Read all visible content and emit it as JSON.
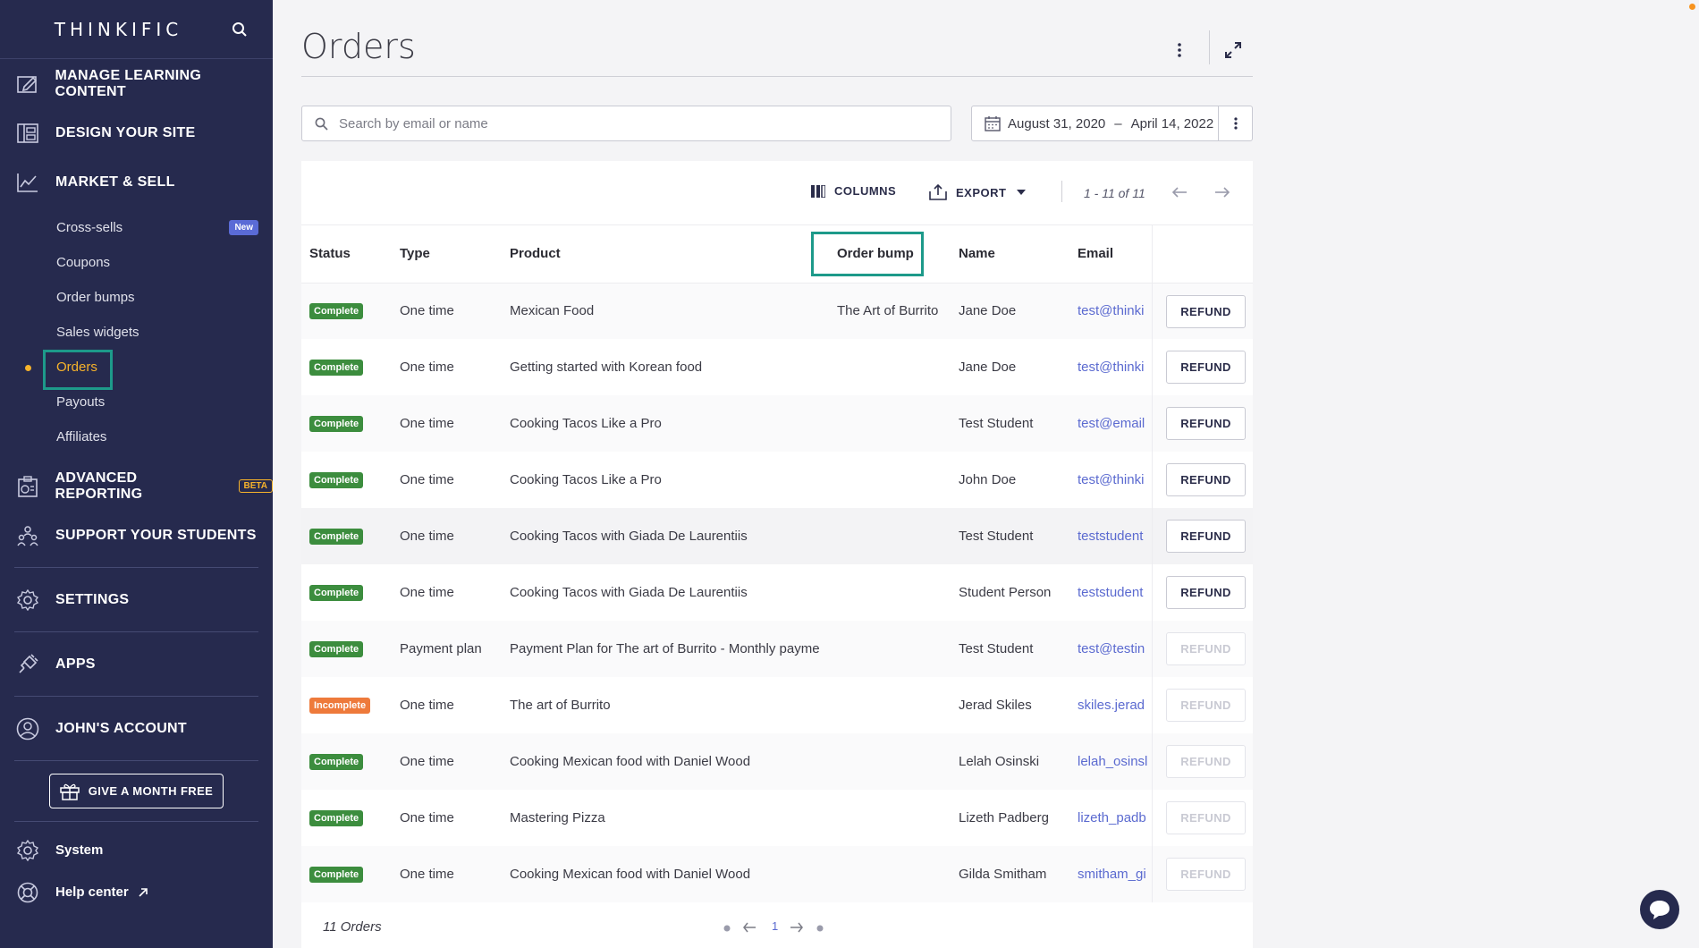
{
  "brand": {
    "name": "THINKIFIC"
  },
  "sidebar": {
    "main_items": [
      {
        "label": "MANAGE LEARNING CONTENT",
        "icon": "edit-content-icon"
      },
      {
        "label": "DESIGN YOUR SITE",
        "icon": "layout-icon"
      },
      {
        "label": "MARKET & SELL",
        "icon": "chart-line-icon"
      }
    ],
    "market_sub": [
      {
        "label": "Cross-sells",
        "badge": "New"
      },
      {
        "label": "Coupons"
      },
      {
        "label": "Order bumps"
      },
      {
        "label": "Sales widgets"
      },
      {
        "label": "Orders",
        "active": true
      },
      {
        "label": "Payouts"
      },
      {
        "label": "Affiliates"
      }
    ],
    "reporting": {
      "label": "ADVANCED REPORTING",
      "badge": "BETA"
    },
    "support": {
      "label": "SUPPORT YOUR STUDENTS"
    },
    "settings": {
      "label": "SETTINGS"
    },
    "apps": {
      "label": "APPS"
    },
    "account": {
      "label": "JOHN'S ACCOUNT"
    },
    "give_month": {
      "label": "GIVE A MONTH FREE"
    },
    "system": {
      "label": "System"
    },
    "help": {
      "label": "Help center"
    }
  },
  "page": {
    "title": "Orders",
    "search_placeholder": "Search by email or name",
    "date_start": "August 31, 2020",
    "date_sep": "–",
    "date_end": "April 14, 2022"
  },
  "toolbar": {
    "columns_label": "COLUMNS",
    "export_label": "EXPORT",
    "range_text": "1 - 11 of 11"
  },
  "table": {
    "headers": {
      "status": "Status",
      "type": "Type",
      "product": "Product",
      "order_bump": "Order bump",
      "name": "Name",
      "email": "Email"
    },
    "refund_label": "REFUND",
    "rows": [
      {
        "status": "Complete",
        "type": "One time",
        "product": "Mexican Food",
        "order_bump": "The Art of Burrito",
        "name": "Jane Doe",
        "email": "test@thinki",
        "refund_enabled": true
      },
      {
        "status": "Complete",
        "type": "One time",
        "product": "Getting started with Korean food",
        "order_bump": "",
        "name": "Jane Doe",
        "email": "test@thinki",
        "refund_enabled": true
      },
      {
        "status": "Complete",
        "type": "One time",
        "product": "Cooking Tacos Like a Pro",
        "order_bump": "",
        "name": "Test Student",
        "email": "test@email",
        "refund_enabled": true
      },
      {
        "status": "Complete",
        "type": "One time",
        "product": "Cooking Tacos Like a Pro",
        "order_bump": "",
        "name": "John Doe",
        "email": "test@thinki",
        "refund_enabled": true
      },
      {
        "status": "Complete",
        "type": "One time",
        "product": "Cooking Tacos with Giada De Laurentiis",
        "order_bump": "",
        "name": "Test Student",
        "email": "teststudent",
        "refund_enabled": true
      },
      {
        "status": "Complete",
        "type": "One time",
        "product": "Cooking Tacos with Giada De Laurentiis",
        "order_bump": "",
        "name": "Student Person",
        "email": "teststudent",
        "refund_enabled": true
      },
      {
        "status": "Complete",
        "type": "Payment plan",
        "product": "Payment Plan for The art of Burrito - Monthly payme",
        "order_bump": "",
        "name": "Test Student",
        "email": "test@testin",
        "refund_enabled": false
      },
      {
        "status": "Incomplete",
        "type": "One time",
        "product": "The art of Burrito",
        "order_bump": "",
        "name": "Jerad Skiles",
        "email": "skiles.jerad",
        "refund_enabled": false
      },
      {
        "status": "Complete",
        "type": "One time",
        "product": "Cooking Mexican food with Daniel Wood",
        "order_bump": "",
        "name": "Lelah Osinski",
        "email": "lelah_osinsl",
        "refund_enabled": false
      },
      {
        "status": "Complete",
        "type": "One time",
        "product": "Mastering Pizza",
        "order_bump": "",
        "name": "Lizeth Padberg",
        "email": "lizeth_padb",
        "refund_enabled": false
      },
      {
        "status": "Complete",
        "type": "One time",
        "product": "Cooking Mexican food with Daniel Wood",
        "order_bump": "",
        "name": "Gilda Smitham",
        "email": "smitham_gi",
        "refund_enabled": false
      }
    ]
  },
  "footer": {
    "orders_count": "11 Orders",
    "current_page": "1"
  },
  "colors": {
    "sidebar_bg": "#262a4e",
    "accent": "#f7b32b",
    "highlight": "#1d9a8a",
    "complete": "#3c8d3e",
    "incomplete": "#ee7a3b",
    "link": "#5b6ad0"
  }
}
